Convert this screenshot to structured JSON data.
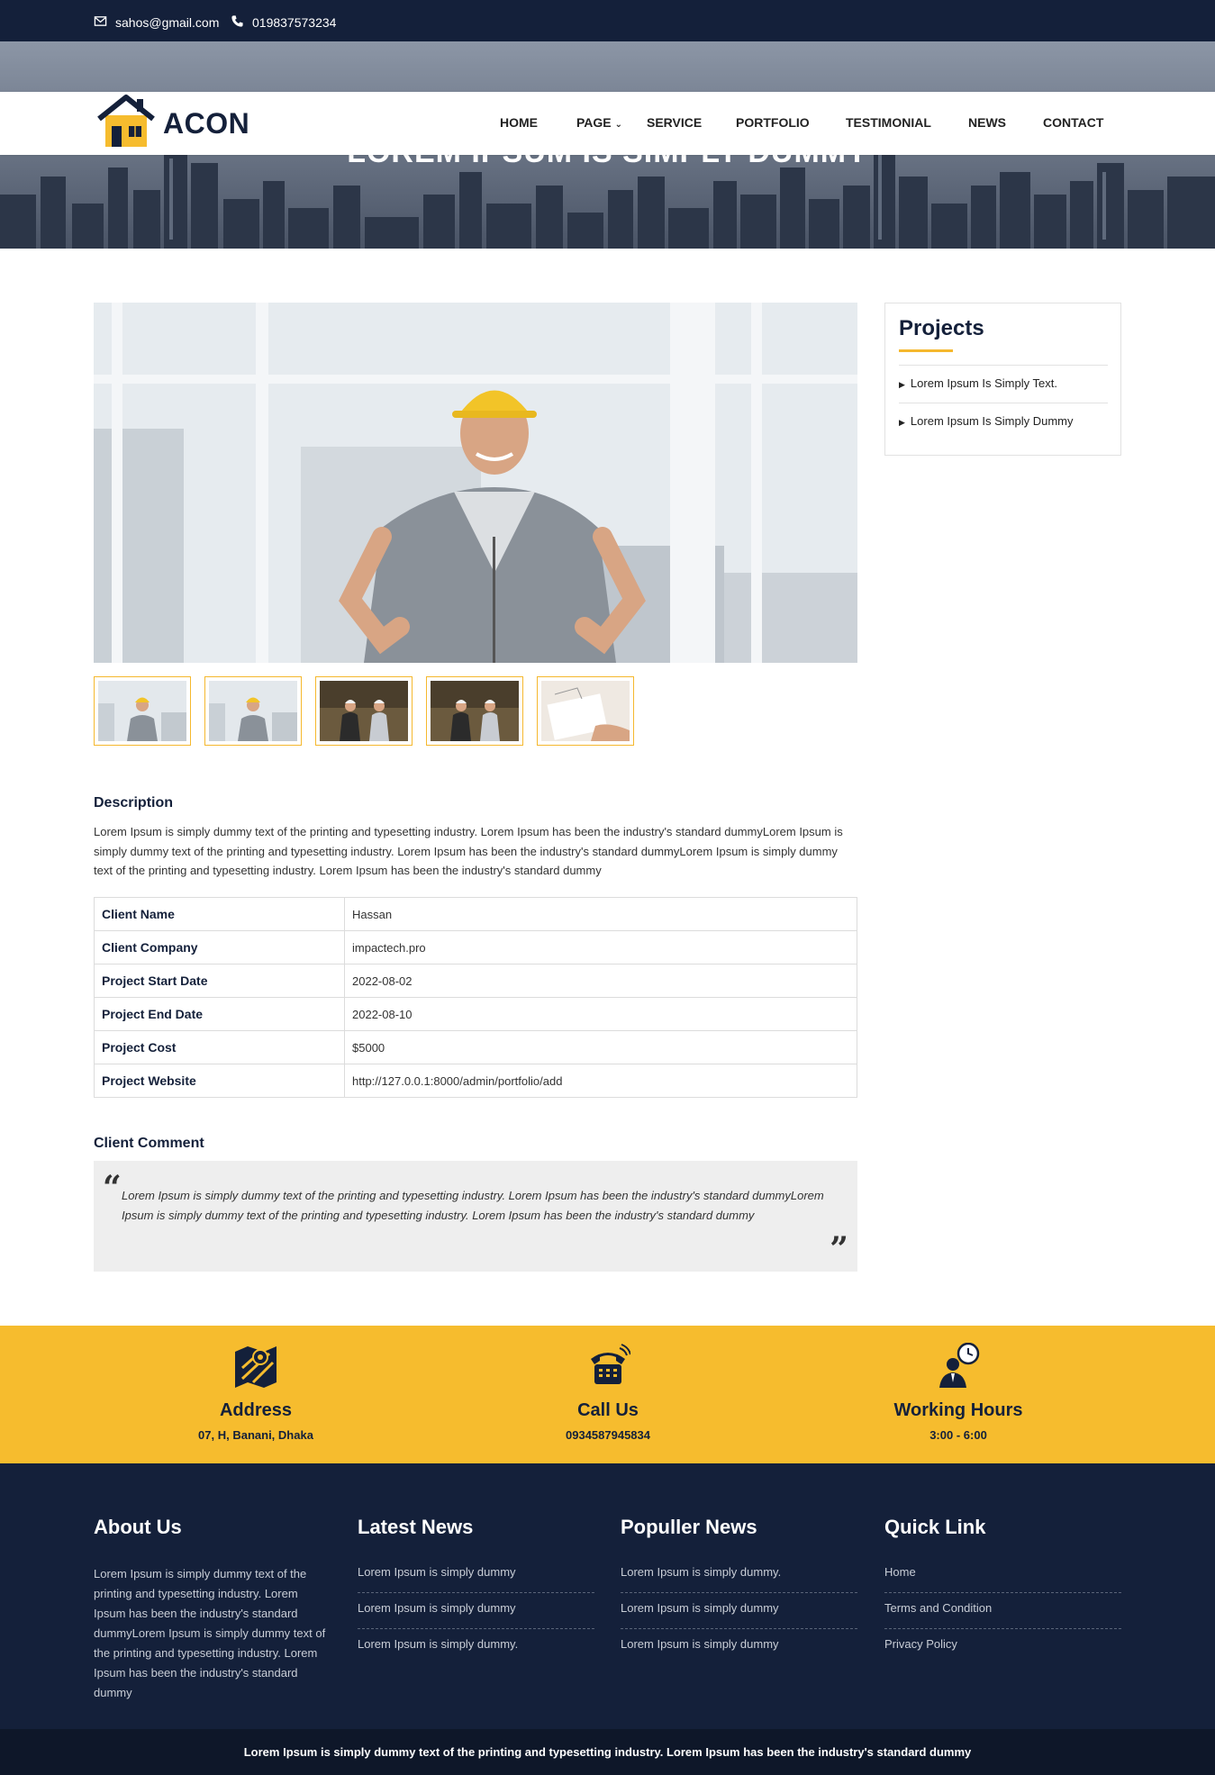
{
  "topbar": {
    "email": "sahos@gmail.com",
    "phone": "019837573234",
    "email_icon": "envelope-icon",
    "phone_icon": "phone-icon"
  },
  "hero": {
    "title": "Lorem Ipsum Is Simply Dummy"
  },
  "brand": {
    "name": "ACON",
    "logo_icon": "house-icon",
    "accent_color": "#f6bc2e",
    "dark_color": "#14203a"
  },
  "nav": {
    "items": [
      "HOME",
      "PAGE",
      "SERVICE",
      "PORTFOLIO",
      "TESTIMONIAL",
      "NEWS",
      "CONTACT"
    ]
  },
  "sidebar": {
    "title": "Projects",
    "links": [
      "Lorem Ipsum Is Simply Text.",
      "Lorem Ipsum Is Simply Dummy"
    ]
  },
  "description": {
    "heading": "Description",
    "text": "Lorem Ipsum is simply dummy text of the printing and typesetting industry. Lorem Ipsum has been the industry's standard dummyLorem Ipsum is simply dummy text of the printing and typesetting industry. Lorem Ipsum has been the industry's standard dummyLorem Ipsum is simply dummy text of the printing and typesetting industry. Lorem Ipsum has been the industry's standard dummy"
  },
  "details": {
    "rows": [
      {
        "label": "Client Name",
        "value": "Hassan"
      },
      {
        "label": "Client Company",
        "value": "impactech.pro"
      },
      {
        "label": "Project Start Date",
        "value": "2022-08-02"
      },
      {
        "label": "Project End Date",
        "value": "2022-08-10"
      },
      {
        "label": "Project Cost",
        "value": "$5000"
      },
      {
        "label": "Project Website",
        "value": "http://127.0.0.1:8000/admin/portfolio/add"
      }
    ]
  },
  "comment": {
    "heading": "Client Comment",
    "text": "Lorem Ipsum is simply dummy text of the printing and typesetting industry. Lorem Ipsum has been the industry's standard dummyLorem Ipsum is simply dummy text of the printing and typesetting industry. Lorem Ipsum has been the industry's standard dummy",
    "open_quote": "“",
    "close_quote": "”"
  },
  "contact": {
    "address": {
      "title": "Address",
      "value": "07, H, Banani, Dhaka",
      "icon": "map-icon"
    },
    "call": {
      "title": "Call Us",
      "value": "0934587945834",
      "icon": "telephone-icon"
    },
    "hours": {
      "title": "Working Hours",
      "value": "3:00 - 6:00",
      "icon": "clock-person-icon"
    }
  },
  "footer": {
    "about": {
      "title": "About Us",
      "text": "Lorem Ipsum is simply dummy text of the printing and typesetting industry. Lorem Ipsum has been the industry's standard dummyLorem Ipsum is simply dummy text of the printing and typesetting industry. Lorem Ipsum has been the industry's standard dummy"
    },
    "latest_news": {
      "title": "Latest News",
      "items": [
        "Lorem Ipsum is simply dummy",
        "Lorem Ipsum is simply dummy",
        "Lorem Ipsum is simply dummy."
      ]
    },
    "popular_news": {
      "title": "Populler News",
      "items": [
        "Lorem Ipsum is simply dummy.",
        "Lorem Ipsum is simply dummy",
        "Lorem Ipsum is simply dummy"
      ]
    },
    "quick_links": {
      "title": "Quick Link",
      "items": [
        "Home",
        "Terms and Condition",
        "Privacy Policy"
      ]
    }
  },
  "copyright": "Lorem Ipsum is simply dummy text of the printing and typesetting industry. Lorem Ipsum has been the industry's standard dummy"
}
